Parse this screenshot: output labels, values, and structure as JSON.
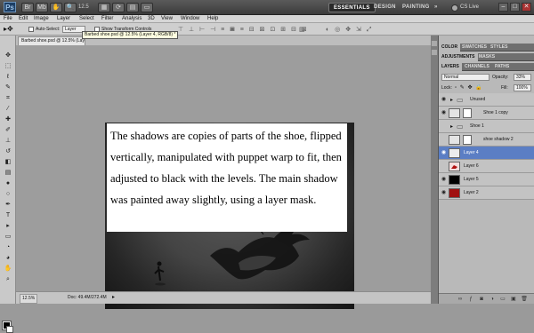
{
  "titlebar": {
    "logo": "Ps",
    "zoom": "12.5",
    "workspaces": [
      "ESSENTIALS",
      "DESIGN",
      "PAINTING"
    ],
    "more": "»",
    "cs_live": "CS Live",
    "window_controls": [
      "–",
      "□",
      "✕"
    ]
  },
  "menu": [
    "File",
    "Edit",
    "Image",
    "Layer",
    "Select",
    "Filter",
    "Analysis",
    "3D",
    "View",
    "Window",
    "Help"
  ],
  "options": {
    "auto_select_label": "Auto-Select:",
    "auto_select_value": "Layer",
    "show_transform_label": "Show Transform Controls"
  },
  "document": {
    "tab_title": "Barbed shoe.psd @ 12.5% (Layer 4, RGB/8)",
    "tooltip": "Barbed shoe.psd @ 12.5% (Layer 4, RGB/8) *",
    "caption": "The shadows are copies of parts of the shoe, flipped vertically, manipulated with puppet warp to fit, then adjusted to black with the levels. The main shadow was painted away slightly, using a layer mask."
  },
  "status": {
    "zoom": "12.5%",
    "doc": "Doc: 49.4M/272.4M"
  },
  "panels": {
    "group1_tabs": [
      "COLOR",
      "SWATCHES",
      "STYLES"
    ],
    "group2_tabs": [
      "ADJUSTMENTS",
      "MASKS"
    ],
    "group3_tabs": [
      "LAYERS",
      "CHANNELS",
      "PATHS"
    ],
    "blend_mode": "Normal",
    "opacity_label": "Opacity:",
    "opacity_value": "33%",
    "lock_label": "Lock:",
    "fill_label": "Fill:",
    "fill_value": "100%",
    "layers": [
      {
        "name": "Unused",
        "visible": true,
        "type": "group"
      },
      {
        "name": "Shoe 1 copy",
        "visible": true,
        "type": "layer"
      },
      {
        "name": "Shoe 1",
        "visible": false,
        "type": "group"
      },
      {
        "name": "shoe shadow 2",
        "visible": false,
        "type": "layer"
      },
      {
        "name": "Layer 4",
        "visible": true,
        "type": "layer",
        "selected": true
      },
      {
        "name": "Layer 6",
        "visible": false,
        "type": "layer"
      },
      {
        "name": "Layer 5",
        "visible": true,
        "type": "layer"
      },
      {
        "name": "Layer 2",
        "visible": true,
        "type": "layer"
      }
    ],
    "footer_icons": [
      "link-icon",
      "fx-icon",
      "mask-icon",
      "adjustment-icon",
      "folder-icon",
      "new-layer-icon",
      "trash-icon"
    ]
  },
  "colors": {
    "selection": "#5b7ec4",
    "layer2_fill": "#a01010",
    "layer5_fill": "#000000"
  }
}
